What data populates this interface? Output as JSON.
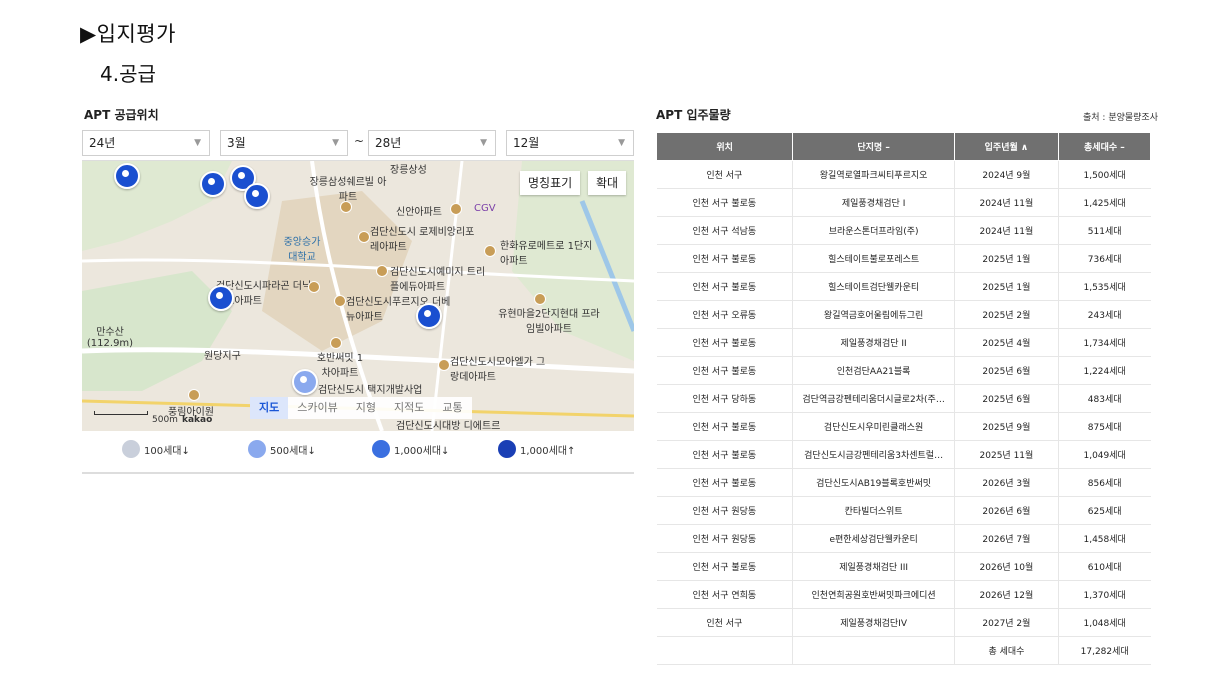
{
  "page": {
    "heading": "▶입지평가",
    "subheading": "4.공급"
  },
  "left_panel": {
    "title": "APT 공급위치",
    "filters": {
      "from_year": "24년",
      "from_month": "3월",
      "tilde": "~",
      "to_year": "28년",
      "to_month": "12월"
    },
    "map": {
      "label_toggle": "명칭표기",
      "zoom_label": "확대",
      "map_types": [
        "지도",
        "스카이뷰",
        "지형",
        "지적도",
        "교통"
      ],
      "scale_text": "500m",
      "provider": "kakao",
      "labels": [
        "장릉상성",
        "장릉삼성쉐르빌 아파트",
        "신안아파트",
        "CGV",
        "중앙승가 대학교",
        "검단신도시 로제비앙리포레아파트",
        "한화유로메트로 1단지아파트",
        "검단신도시예미지 트리플에듀아파트",
        "검단신도시파라곤 더닉파크아파트",
        "검단신도시푸르지오 더베뉴아파트",
        "유현마을2단지현대 프라임빌아파트",
        "만수산 (112.9m)",
        "원당지구",
        "호반써밋 1차아파트",
        "검단신도시모아엘가 그랑데아파트",
        "검단신도시 택지개발사업",
        "풍림아이원",
        "검단신도시대방 디에트르"
      ]
    },
    "legend": [
      {
        "label": "100세대↓",
        "color": "#c9cfdb"
      },
      {
        "label": "500세대↓",
        "color": "#8aa9ee"
      },
      {
        "label": "1,000세대↓",
        "color": "#3a6fe0"
      },
      {
        "label": "1,000세대↑",
        "color": "#1a3fb5"
      }
    ]
  },
  "right_panel": {
    "title": "APT 입주물량",
    "source": "출처 : 분양물량조사",
    "columns": [
      "위치",
      "단지명 –",
      "입주년월 ∧",
      "총세대수 –"
    ],
    "rows": [
      [
        "인천 서구",
        "왕길역로열파크씨티푸르지오",
        "2024년 9월",
        "1,500세대"
      ],
      [
        "인천 서구 불로동",
        "제일풍경채검단 I",
        "2024년 11월",
        "1,425세대"
      ],
      [
        "인천 서구 석남동",
        "브라운스톤더프라임(주)",
        "2024년 11월",
        "511세대"
      ],
      [
        "인천 서구 불로동",
        "힐스테이트불로포레스트",
        "2025년 1월",
        "736세대"
      ],
      [
        "인천 서구 불로동",
        "힐스테이트검단웰카운티",
        "2025년 1월",
        "1,535세대"
      ],
      [
        "인천 서구 오류동",
        "왕길역금호어울림에듀그린",
        "2025년 2월",
        "243세대"
      ],
      [
        "인천 서구 불로동",
        "제일풍경채검단 II",
        "2025년 4월",
        "1,734세대"
      ],
      [
        "인천 서구 불로동",
        "인천검단AA21블록",
        "2025년 6월",
        "1,224세대"
      ],
      [
        "인천 서구 당하동",
        "검단역금강펜테리움더시글로2차(주…",
        "2025년 6월",
        "483세대"
      ],
      [
        "인천 서구 불로동",
        "검단신도시우미린클래스원",
        "2025년 9월",
        "875세대"
      ],
      [
        "인천 서구 불로동",
        "검단신도시금강펜테리움3차센트럴…",
        "2025년 11월",
        "1,049세대"
      ],
      [
        "인천 서구 불로동",
        "검단신도시AB19블록호반써밋",
        "2026년 3월",
        "856세대"
      ],
      [
        "인천 서구 원당동",
        "칸타빌더스위트",
        "2026년 6월",
        "625세대"
      ],
      [
        "인천 서구 원당동",
        "e편한세상검단웰카운티",
        "2026년 7월",
        "1,458세대"
      ],
      [
        "인천 서구 불로동",
        "제일풍경채검단 III",
        "2026년 10월",
        "610세대"
      ],
      [
        "인천 서구 연희동",
        "인천연희공원호반써밋파크에디션",
        "2026년 12월",
        "1,370세대"
      ],
      [
        "인천 서구",
        "제일풍경채검단IV",
        "2027년 2월",
        "1,048세대"
      ],
      [
        "",
        "",
        "총 세대수",
        "17,282세대"
      ]
    ]
  }
}
